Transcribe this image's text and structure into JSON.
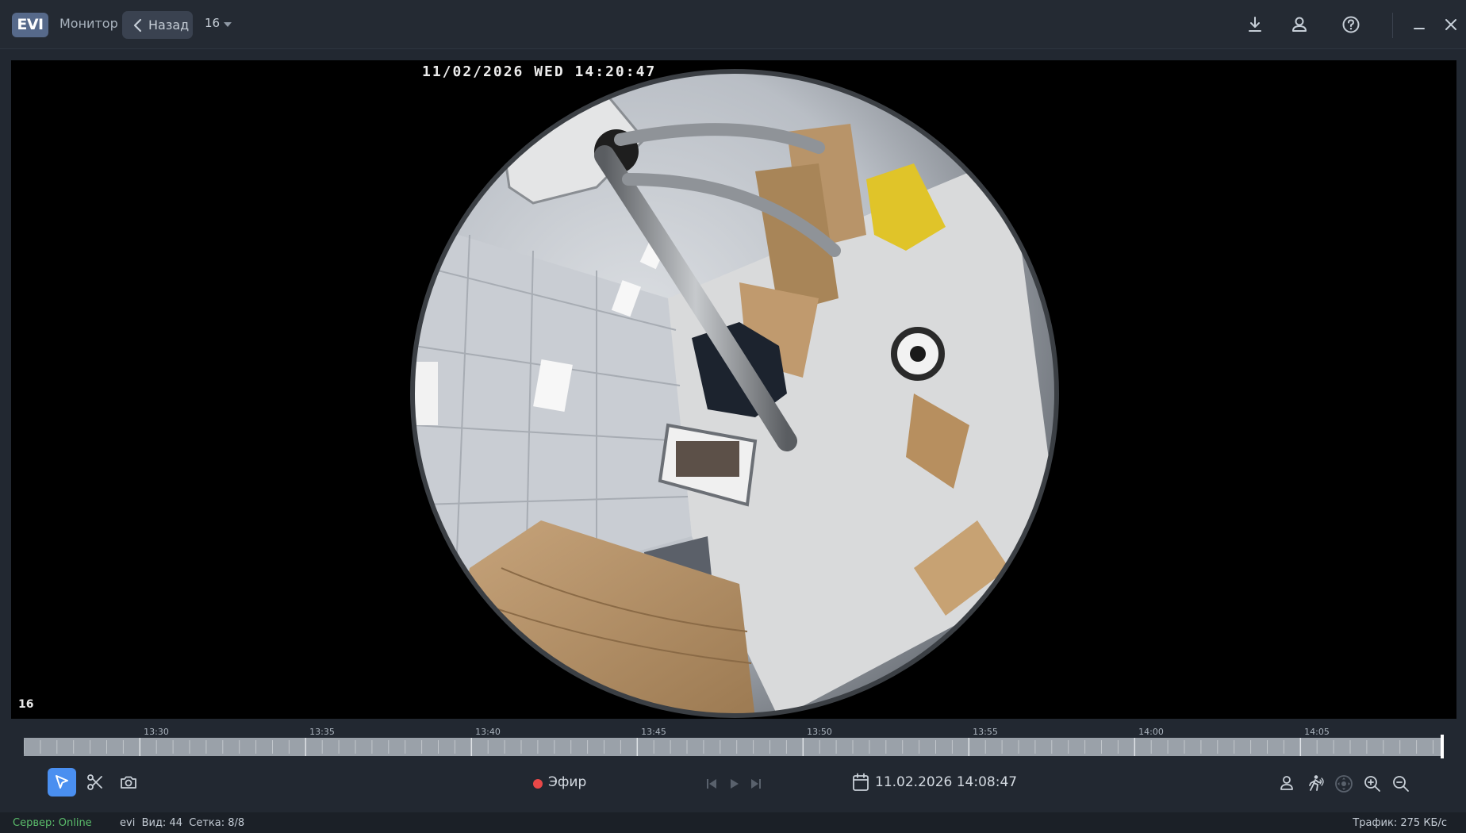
{
  "header": {
    "logo": "EVI",
    "monitor_label": "Монитор",
    "back_label": "Назад",
    "camera_select": "16"
  },
  "video": {
    "osd_timestamp": "11/02/2026 WED 14:20:47",
    "camera_number": "16"
  },
  "timeline": {
    "labels": [
      "13:30",
      "13:35",
      "13:40",
      "13:45",
      "13:50",
      "13:55",
      "14:00",
      "14:05"
    ]
  },
  "controls": {
    "live_label": "Эфир",
    "datetime": "11.02.2026 14:08:47"
  },
  "status": {
    "server": "Сервер: Online",
    "user": "evi",
    "view": "Вид: 44",
    "grid": "Сетка: 8/8",
    "traffic": "Трафик: 275 КБ/с"
  },
  "colors": {
    "accent": "#4a8ff0",
    "online": "#5bbd6b",
    "live_dot": "#e94848"
  }
}
